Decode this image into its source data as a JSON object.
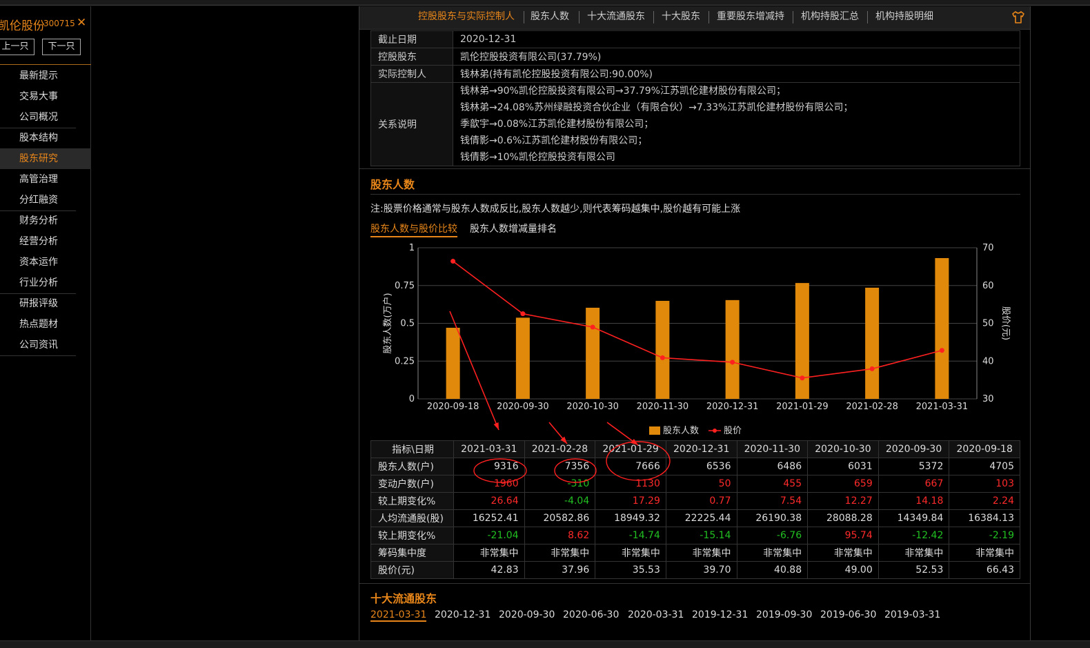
{
  "sidebar": {
    "stock_name": "凯伦股份",
    "stock_code": "300715",
    "close_symbol": "✕",
    "prev_label": "上一只",
    "next_label": "下一只",
    "items": [
      "最新提示",
      "交易大事",
      "公司概况",
      "股本结构",
      "股东研究",
      "高管治理",
      "分红融资",
      "财务分析",
      "经营分析",
      "资本运作",
      "行业分析",
      "研报评级",
      "热点题材",
      "公司资讯"
    ],
    "active_index": 4
  },
  "tabs": [
    "控股股东与实际控制人",
    "股东人数",
    "十大流通股东",
    "十大股东",
    "重要股东增减持",
    "机构持股汇总",
    "机构持股明细"
  ],
  "info": {
    "deadline_label": "截止日期",
    "deadline_value": "2020-12-31",
    "holder_label": "控股股东",
    "holder_value": "凯伦控股投资有限公司(37.79%)",
    "controller_label": "实际控制人",
    "controller_value": "钱林弟(持有凯伦控股投资有限公司:90.00%)",
    "relation_label": "关系说明",
    "relations": [
      "钱林弟→90%凯伦控股投资有限公司→37.79%江苏凯伦建材股份有限公司；",
      "钱林弟→24.08%苏州绿融投资合伙企业（有限合伙）→7.33%江苏凯伦建材股份有限公司；",
      "季歆宇→0.08%江苏凯伦建材股份有限公司；",
      "钱倩影→0.6%江苏凯伦建材股份有限公司；",
      "钱倩影→10%凯伦控股投资有限公司"
    ]
  },
  "holders_section": {
    "title": "股东人数",
    "note": "注:股票价格通常与股东人数成反比,股东人数越少,则代表筹码越集中,股价越有可能上涨",
    "subtab_active": "股东人数与股价比较",
    "subtab_other": "股东人数增减量排名"
  },
  "chart_data": {
    "type": "bar",
    "categories": [
      "2020-09-18",
      "2020-09-30",
      "2020-10-30",
      "2020-11-30",
      "2020-12-31",
      "2021-01-29",
      "2021-02-28",
      "2021-03-31"
    ],
    "series": [
      {
        "name": "股东人数",
        "type": "bar",
        "axis": "left",
        "values": [
          0.4705,
          0.5372,
          0.6031,
          0.6486,
          0.6536,
          0.7666,
          0.7356,
          0.9316
        ]
      },
      {
        "name": "股价",
        "type": "line",
        "axis": "right",
        "values": [
          66.43,
          52.53,
          49.0,
          40.88,
          39.7,
          35.53,
          37.96,
          42.83
        ]
      }
    ],
    "ylabel": "股东人数(万户)",
    "ylabel_right": "股价(元)",
    "ylim": [
      0,
      1
    ],
    "ylim_right": [
      30,
      70
    ],
    "yticks": [
      "0",
      "0.25",
      "0.5",
      "0.75",
      "1"
    ],
    "yticks_right": [
      "30",
      "40",
      "50",
      "60",
      "70"
    ],
    "legend_position": "bottom",
    "colors": {
      "bar": "#e0890a",
      "line": "#ff2020",
      "grid": "#444"
    }
  },
  "table": {
    "header_label": "指标\\日期",
    "dates": [
      "2021-03-31",
      "2021-02-28",
      "2021-01-29",
      "2020-12-31",
      "2020-11-30",
      "2020-10-30",
      "2020-09-30",
      "2020-09-18"
    ],
    "rows": [
      {
        "label": "股东人数(户)",
        "cls": [
          "",
          "",
          "",
          "",
          "",
          "",
          "",
          ""
        ],
        "values": [
          "9316",
          "7356",
          "7666",
          "6536",
          "6486",
          "6031",
          "5372",
          "4705"
        ]
      },
      {
        "label": "变动户数(户)",
        "cls": [
          "red",
          "green",
          "red",
          "red",
          "red",
          "red",
          "red",
          "red"
        ],
        "values": [
          "1960",
          "-310",
          "1130",
          "50",
          "455",
          "659",
          "667",
          "103"
        ]
      },
      {
        "label": "较上期变化%",
        "cls": [
          "red",
          "green",
          "red",
          "red",
          "red",
          "red",
          "red",
          "red"
        ],
        "values": [
          "26.64",
          "-4.04",
          "17.29",
          "0.77",
          "7.54",
          "12.27",
          "14.18",
          "2.24"
        ]
      },
      {
        "label": "人均流通股(股)",
        "cls": [
          "",
          "",
          "",
          "",
          "",
          "",
          "",
          ""
        ],
        "values": [
          "16252.41",
          "20582.86",
          "18949.32",
          "22225.44",
          "26190.38",
          "28088.28",
          "14349.84",
          "16384.13"
        ]
      },
      {
        "label": "较上期变化%",
        "cls": [
          "green",
          "red",
          "green",
          "green",
          "green",
          "red",
          "green",
          "green"
        ],
        "values": [
          "-21.04",
          "8.62",
          "-14.74",
          "-15.14",
          "-6.76",
          "95.74",
          "-12.42",
          "-2.19"
        ]
      },
      {
        "label": "筹码集中度",
        "cls": [
          "",
          "",
          "",
          "",
          "",
          "",
          "",
          ""
        ],
        "values": [
          "非常集中",
          "非常集中",
          "非常集中",
          "非常集中",
          "非常集中",
          "非常集中",
          "非常集中",
          "非常集中"
        ]
      },
      {
        "label": "股价(元)",
        "cls": [
          "",
          "",
          "",
          "",
          "",
          "",
          "",
          ""
        ],
        "values": [
          "42.83",
          "37.96",
          "35.53",
          "39.70",
          "40.88",
          "49.00",
          "52.53",
          "66.43"
        ]
      }
    ]
  },
  "top10_section": {
    "title": "十大流通股东",
    "dates": [
      "2021-03-31",
      "2020-12-31",
      "2020-09-30",
      "2020-06-30",
      "2020-03-31",
      "2019-12-31",
      "2019-09-30",
      "2019-06-30",
      "2019-03-31"
    ]
  },
  "annotation_color": "#ff2020"
}
